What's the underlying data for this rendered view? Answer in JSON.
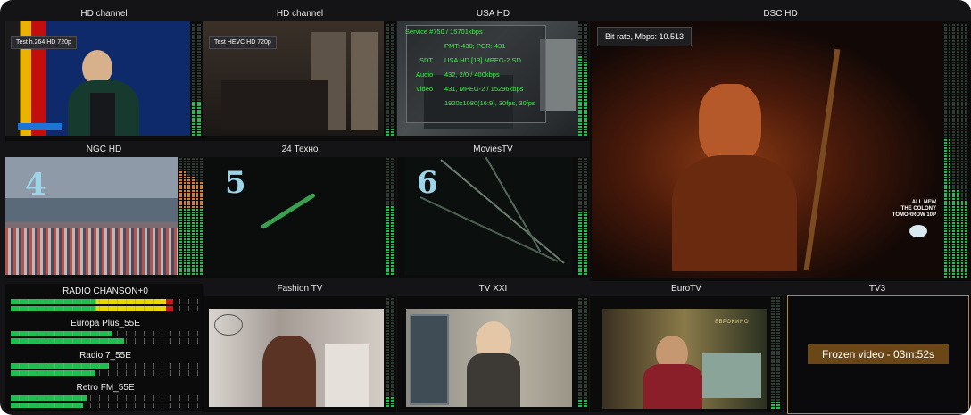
{
  "tiles": {
    "t1": {
      "title": "HD channel",
      "badge": "Test h.264 HD 720p"
    },
    "t2": {
      "title": "HD channel",
      "badge": "Test HEVC HD 720p"
    },
    "t3": {
      "title": "USA HD",
      "service": {
        "line1": "Service #750 / 15701kbps",
        "line2": "PMT: 430; PCR: 431",
        "sdt_label": "SDT",
        "sdt_value": "USA HD [13] MPEG-2 SD",
        "audio_label": "Audio",
        "audio_value": "432, 2/0 / 400kbps",
        "video_label": "Video",
        "video_value": "431, MPEG-2 / 15296kbps",
        "res_value": "1920x1080(16:9), 30fps, 30fps"
      }
    },
    "t4": {
      "title": "DSC HD",
      "bitrate": "Bit rate, Mbps: 10.513",
      "promo_line1": "ALL NEW",
      "promo_line2": "THE COLONY",
      "promo_line3": "TOMORROW 10P"
    },
    "t5": {
      "title": "NGC HD",
      "number": "4"
    },
    "t6": {
      "title": "24 Техно",
      "number": "5"
    },
    "t7": {
      "title": "MoviesTV",
      "number": "6"
    },
    "t8": {
      "title": "Fashion TV"
    },
    "t9": {
      "title": "TV XXI"
    },
    "t10": {
      "title": "EuroTV",
      "logo": "EBPOKИHO"
    },
    "t11": {
      "title": "TV3",
      "alert": "Frozen video - 03m:52s"
    }
  },
  "radio": [
    {
      "name": "RADIO CHANSON+0",
      "fill_a": 0.82,
      "fill_b": 0.82,
      "color": "#e8d800"
    },
    {
      "name": "Europa Plus_55E",
      "fill_a": 0.54,
      "fill_b": 0.6,
      "color": "#22c55e"
    },
    {
      "name": "Radio 7_55E",
      "fill_a": 0.52,
      "fill_b": 0.45,
      "color": "#22c55e"
    },
    {
      "name": "Retro FM_55E",
      "fill_a": 0.4,
      "fill_b": 0.38,
      "color": "#22c55e"
    }
  ],
  "colors": {
    "meter_green": "#1fbf4f",
    "meter_yellow": "#d6c400",
    "meter_orange": "#e37b1c",
    "alert_bg": "#6b4718",
    "frame_orange": "#b78733"
  }
}
